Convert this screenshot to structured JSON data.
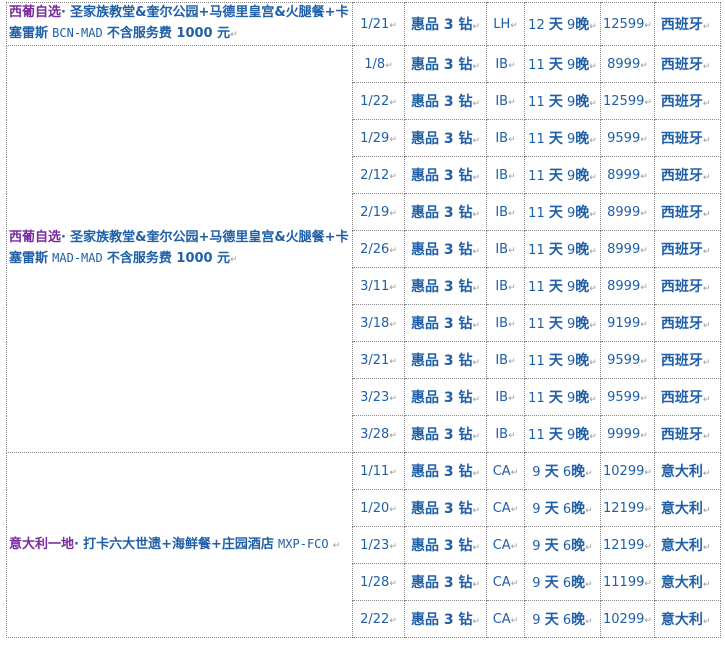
{
  "groups": [
    {
      "title": "西葡自选",
      "sep": "·",
      "route": "圣家族教堂&奎尔公园+马德里皇宫&火腿餐+卡塞雷斯",
      "code": "BCN-MAD",
      "note": "不含服务费 1000 元",
      "rows": [
        {
          "date": "1/21",
          "prod": "惠品 3 钻",
          "air": "LH",
          "dur_a": "12",
          "dur_b": "天",
          "dur_c": "9",
          "dur_d": "晚",
          "price": "12599",
          "dest": "西班牙"
        }
      ]
    },
    {
      "title": "西葡自选",
      "sep": "·",
      "route": "圣家族教堂&奎尔公园+马德里皇宫&火腿餐+卡塞雷斯",
      "code": "MAD-MAD",
      "note": "不含服务费 1000 元",
      "rows": [
        {
          "date": "1/8",
          "prod": "惠品 3 钻",
          "air": "IB",
          "dur_a": "11",
          "dur_b": "天",
          "dur_c": "9",
          "dur_d": "晚",
          "price": "8999",
          "dest": "西班牙"
        },
        {
          "date": "1/22",
          "prod": "惠品 3 钻",
          "air": "IB",
          "dur_a": "11",
          "dur_b": "天",
          "dur_c": "9",
          "dur_d": "晚",
          "price": "12599",
          "dest": "西班牙"
        },
        {
          "date": "1/29",
          "prod": "惠品 3 钻",
          "air": "IB",
          "dur_a": "11",
          "dur_b": "天",
          "dur_c": "9",
          "dur_d": "晚",
          "price": "9599",
          "dest": "西班牙"
        },
        {
          "date": "2/12",
          "prod": "惠品 3 钻",
          "air": "IB",
          "dur_a": "11",
          "dur_b": "天",
          "dur_c": "9",
          "dur_d": "晚",
          "price": "8999",
          "dest": "西班牙"
        },
        {
          "date": "2/19",
          "prod": "惠品 3 钻",
          "air": "IB",
          "dur_a": "11",
          "dur_b": "天",
          "dur_c": "9",
          "dur_d": "晚",
          "price": "8999",
          "dest": "西班牙"
        },
        {
          "date": "2/26",
          "prod": "惠品 3 钻",
          "air": "IB",
          "dur_a": "11",
          "dur_b": "天",
          "dur_c": "9",
          "dur_d": "晚",
          "price": "8999",
          "dest": "西班牙"
        },
        {
          "date": "3/11",
          "prod": "惠品 3 钻",
          "air": "IB",
          "dur_a": "11",
          "dur_b": "天",
          "dur_c": "9",
          "dur_d": "晚",
          "price": "8999",
          "dest": "西班牙"
        },
        {
          "date": "3/18",
          "prod": "惠品 3 钻",
          "air": "IB",
          "dur_a": "11",
          "dur_b": "天",
          "dur_c": "9",
          "dur_d": "晚",
          "price": "9199",
          "dest": "西班牙"
        },
        {
          "date": "3/21",
          "prod": "惠品 3 钻",
          "air": "IB",
          "dur_a": "11",
          "dur_b": "天",
          "dur_c": "9",
          "dur_d": "晚",
          "price": "9599",
          "dest": "西班牙"
        },
        {
          "date": "3/23",
          "prod": "惠品 3 钻",
          "air": "IB",
          "dur_a": "11",
          "dur_b": "天",
          "dur_c": "9",
          "dur_d": "晚",
          "price": "9599",
          "dest": "西班牙"
        },
        {
          "date": "3/28",
          "prod": "惠品 3 钻",
          "air": "IB",
          "dur_a": "11",
          "dur_b": "天",
          "dur_c": "9",
          "dur_d": "晚",
          "price": "9999",
          "dest": "西班牙"
        }
      ]
    },
    {
      "title": "意大利一地",
      "sep": "·",
      "route": "打卡六大世遗+海鲜餐+庄园酒店",
      "code": "MXP-FCO",
      "note": "",
      "rows": [
        {
          "date": "1/11",
          "prod": "惠品 3 钻",
          "air": "CA",
          "dur_a": "9",
          "dur_b": "天",
          "dur_c": "6",
          "dur_d": "晚",
          "price": "10299",
          "dest": "意大利"
        },
        {
          "date": "1/20",
          "prod": "惠品 3 钻",
          "air": "CA",
          "dur_a": "9",
          "dur_b": "天",
          "dur_c": "6",
          "dur_d": "晚",
          "price": "12199",
          "dest": "意大利"
        },
        {
          "date": "1/23",
          "prod": "惠品 3 钻",
          "air": "CA",
          "dur_a": "9",
          "dur_b": "天",
          "dur_c": "6",
          "dur_d": "晚",
          "price": "12199",
          "dest": "意大利"
        },
        {
          "date": "1/28",
          "prod": "惠品 3 钻",
          "air": "CA",
          "dur_a": "9",
          "dur_b": "天",
          "dur_c": "6",
          "dur_d": "晚",
          "price": "11199",
          "dest": "意大利"
        },
        {
          "date": "2/22",
          "prod": "惠品 3 钻",
          "air": "CA",
          "dur_a": "9",
          "dur_b": "天",
          "dur_c": "6",
          "dur_d": "晚",
          "price": "10299",
          "dest": "意大利"
        }
      ]
    }
  ],
  "colors": {
    "accent_blue": "#1f5fa8",
    "accent_purple": "#7a2aa0",
    "grid": "#8a8a8a"
  },
  "paragraph_mark": "↵"
}
